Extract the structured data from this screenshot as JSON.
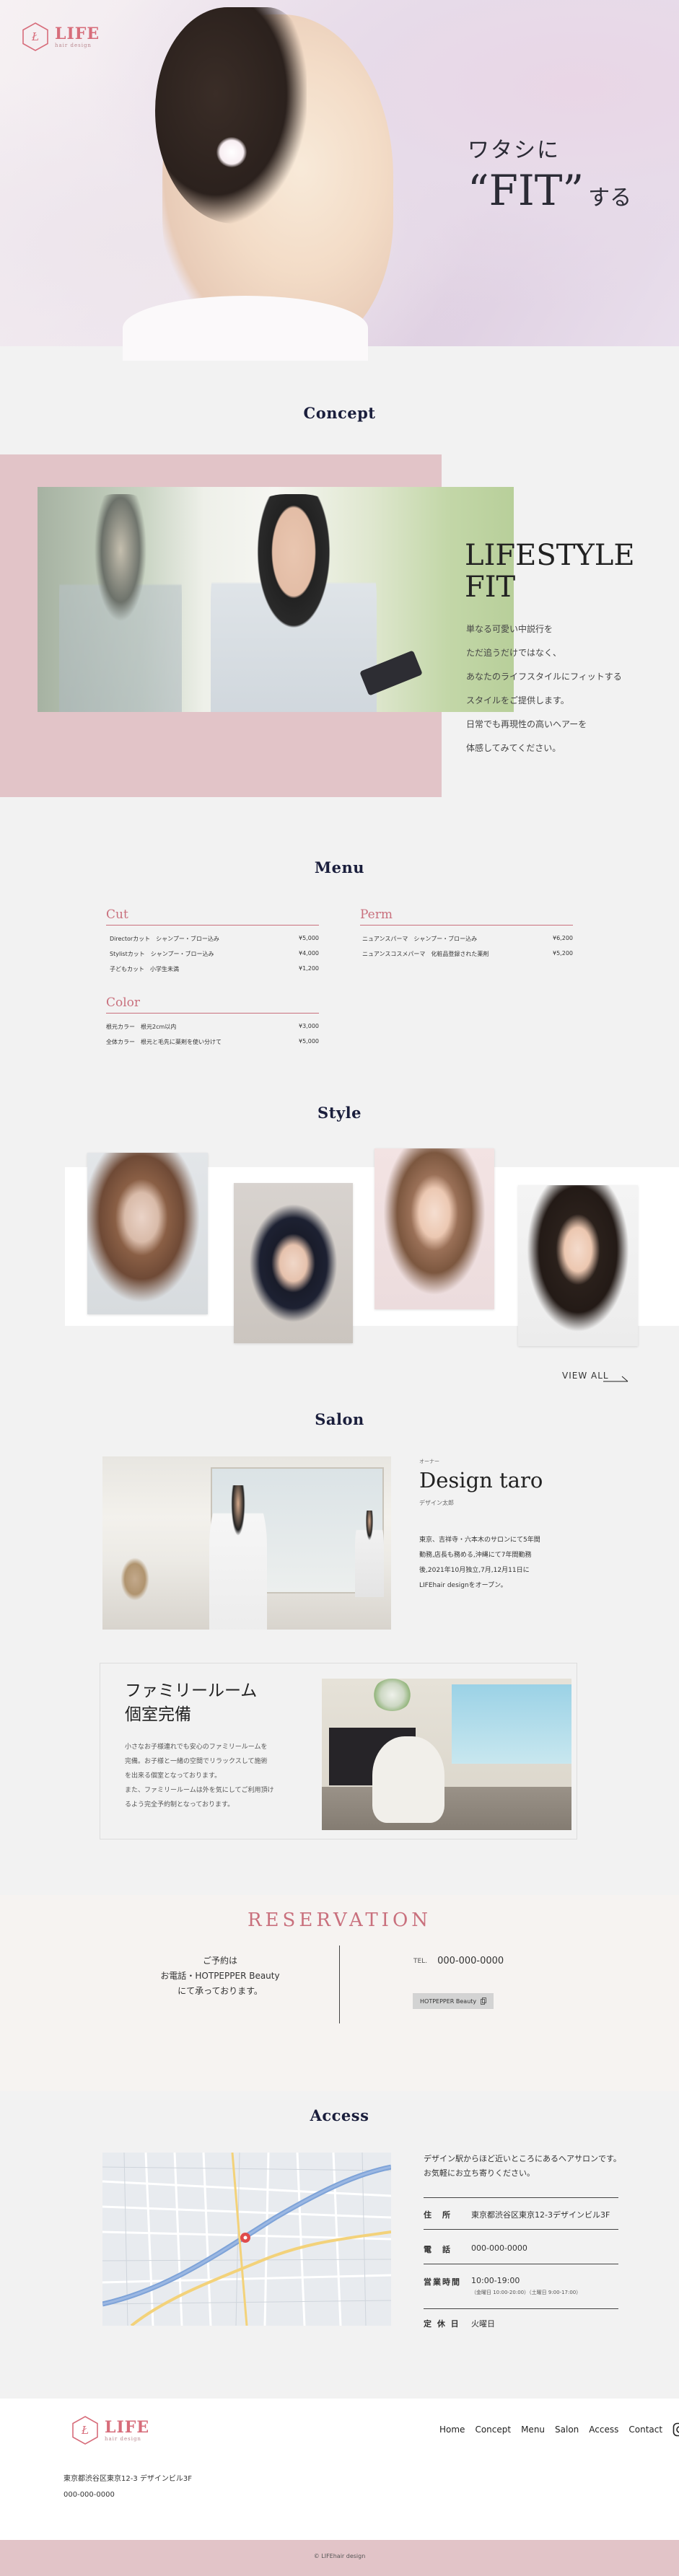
{
  "header": {
    "logo_text": "LIFE",
    "logo_subtext": "hair design"
  },
  "hero": {
    "line1": "ワタシに",
    "line2": "“FIT”",
    "line3": "する"
  },
  "concept": {
    "section_title": "Concept",
    "heading_line1": "LIFESTYLE",
    "heading_line2": "FIT",
    "paragraphs": [
      "単なる可愛い中説行を",
      "ただ追うだけではなく、",
      "あなたのライフスタイルにフィットする",
      "スタイルをご提供します。",
      "日常でも再現性の高いヘアーを",
      "体感してみてください。"
    ]
  },
  "menu": {
    "section_title": "Menu",
    "cut": {
      "title": "Cut",
      "items": [
        {
          "name": "Directorカット　シャンプー・ブロー込み",
          "price": "¥5,000"
        },
        {
          "name": "Stylistカット　シャンプー・ブロー込み",
          "price": "¥4,000"
        },
        {
          "name": "子どもカット　小学生未満",
          "price": "¥1,200"
        }
      ]
    },
    "perm": {
      "title": "Perm",
      "items": [
        {
          "name": "ニュアンスパーマ　シャンプー・ブロー込み",
          "price": "¥6,200"
        },
        {
          "name": "ニュアンスコスメパーマ　化粧品登録された薬剤",
          "price": "¥5,200"
        }
      ]
    },
    "color": {
      "title": "Color",
      "items": [
        {
          "name": "根元カラー　根元2cm以内",
          "price": "¥3,000"
        },
        {
          "name": "全体カラー　根元と毛先に薬剤を使い分けて",
          "price": "¥5,000"
        }
      ]
    }
  },
  "style": {
    "section_title": "Style",
    "view_all": "VIEW ALL"
  },
  "salon": {
    "section_title": "Salon",
    "role": "オーナー",
    "name": "Design taro",
    "role2": "デザイン太郎",
    "bio": [
      "東京、吉祥寺・六本木のサロンにて5年間",
      "勤務,店長も務める,沖縄にて7年間勤務",
      "後,2021年10月独立,7月,12月11日に",
      "LIFEhair designをオープン。"
    ],
    "family_title_line1": "ファミリールーム",
    "family_title_line2": "個室完備",
    "family_text": [
      "小さなお子様連れでも安心のファミリールームを",
      "完備。お子様と一緒の空間でリラックスして施術",
      "を出来る個室となっております。",
      "また、ファミリールームは外を気にしてご利用頂け",
      "るよう完全予約制となっております。"
    ]
  },
  "reservation": {
    "title": "RESERVATION",
    "left_lines": [
      "ご予約は",
      "お電話・HOTPEPPER Beauty",
      "にて承っております。"
    ],
    "tel_label": "TEL.",
    "tel": "000-000-0000",
    "hp_button": "HOTPEPPER Beauty"
  },
  "access": {
    "section_title": "Access",
    "lead_line1": "デザイン駅からほど近いところにあるヘアサロンです。",
    "lead_line2": "お気軽にお立ち寄りください。",
    "address_label": "住　所",
    "address": "東京都渋谷区東京12-3デザインビル3F",
    "phone_label": "電　話",
    "phone": "000-000-0000",
    "hours_label": "営業時間",
    "hours": "10:00-19:00",
    "hours_note": "（金曜日 10:00-20:00）（土曜日 9:00-17:00）",
    "holiday_label": "定 休 日",
    "holiday": "火曜日"
  },
  "footer": {
    "nav": [
      "Home",
      "Concept",
      "Menu",
      "Salon",
      "Access",
      "Contact"
    ],
    "address": "東京都渋谷区東京12-3 デザインビル3F",
    "phone": "000-000-0000",
    "copyright": "© LIFEhair design"
  },
  "colors": {
    "accent": "#c9707d",
    "pink_block": "#e2c4c8",
    "navy_heading": "#1a1e3c"
  }
}
